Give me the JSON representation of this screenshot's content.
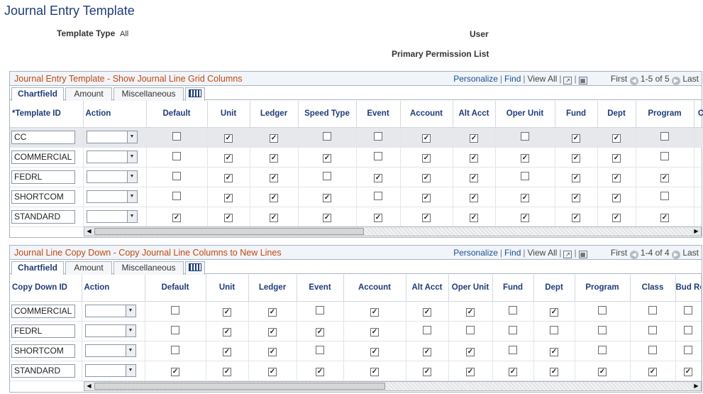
{
  "page": {
    "title": "Journal Entry Template"
  },
  "header": {
    "template_type_label": "Template Type",
    "template_type_value": "All",
    "user_label": "User",
    "permission_label": "Primary Permission List"
  },
  "grid1": {
    "title": "Journal Entry Template - Show Journal Line Grid Columns",
    "nav": {
      "personalize": "Personalize",
      "find": "Find",
      "view_all": "View All",
      "first": "First",
      "range": "1-5 of 5",
      "last": "Last"
    },
    "tabs": [
      "Chartfield",
      "Amount",
      "Miscellaneous"
    ],
    "columns": [
      "*Template ID",
      "Action",
      "Default",
      "Unit",
      "Ledger",
      "Speed Type",
      "Event",
      "Account",
      "Alt Acct",
      "Oper Unit",
      "Fund",
      "Dept",
      "Program",
      "C"
    ],
    "rows": [
      {
        "id": "CC",
        "checks": [
          0,
          1,
          1,
          0,
          0,
          1,
          1,
          0,
          1,
          1,
          0
        ]
      },
      {
        "id": "COMMERCIAL",
        "checks": [
          0,
          1,
          1,
          1,
          0,
          1,
          1,
          1,
          1,
          1,
          0
        ]
      },
      {
        "id": "FEDRL",
        "checks": [
          0,
          1,
          1,
          0,
          1,
          1,
          1,
          0,
          1,
          1,
          1
        ]
      },
      {
        "id": "SHORTCOM",
        "checks": [
          0,
          1,
          1,
          1,
          0,
          1,
          1,
          1,
          1,
          1,
          0
        ]
      },
      {
        "id": "STANDARD",
        "checks": [
          1,
          1,
          1,
          1,
          1,
          1,
          1,
          1,
          1,
          1,
          1
        ]
      }
    ]
  },
  "grid2": {
    "title": "Journal Line Copy Down - Copy Journal Line Columns to New Lines",
    "nav": {
      "personalize": "Personalize",
      "find": "Find",
      "view_all": "View All",
      "first": "First",
      "range": "1-4 of 4",
      "last": "Last"
    },
    "tabs": [
      "Chartfield",
      "Amount",
      "Miscellaneous"
    ],
    "columns": [
      "Copy Down ID",
      "Action",
      "Default",
      "Unit",
      "Ledger",
      "Event",
      "Account",
      "Alt Acct",
      "Oper Unit",
      "Fund",
      "Dept",
      "Program",
      "Class",
      "Bud Ref"
    ],
    "rows": [
      {
        "id": "COMMERCIAL",
        "checks": [
          0,
          1,
          1,
          0,
          1,
          1,
          1,
          0,
          1,
          0,
          0,
          0
        ]
      },
      {
        "id": "FEDRL",
        "checks": [
          0,
          1,
          1,
          1,
          1,
          0,
          0,
          0,
          0,
          0,
          0,
          0
        ]
      },
      {
        "id": "SHORTCOM",
        "checks": [
          0,
          1,
          1,
          0,
          1,
          1,
          1,
          0,
          1,
          0,
          0,
          0
        ]
      },
      {
        "id": "STANDARD",
        "checks": [
          1,
          1,
          1,
          1,
          1,
          1,
          1,
          1,
          1,
          1,
          1,
          1
        ]
      }
    ]
  }
}
